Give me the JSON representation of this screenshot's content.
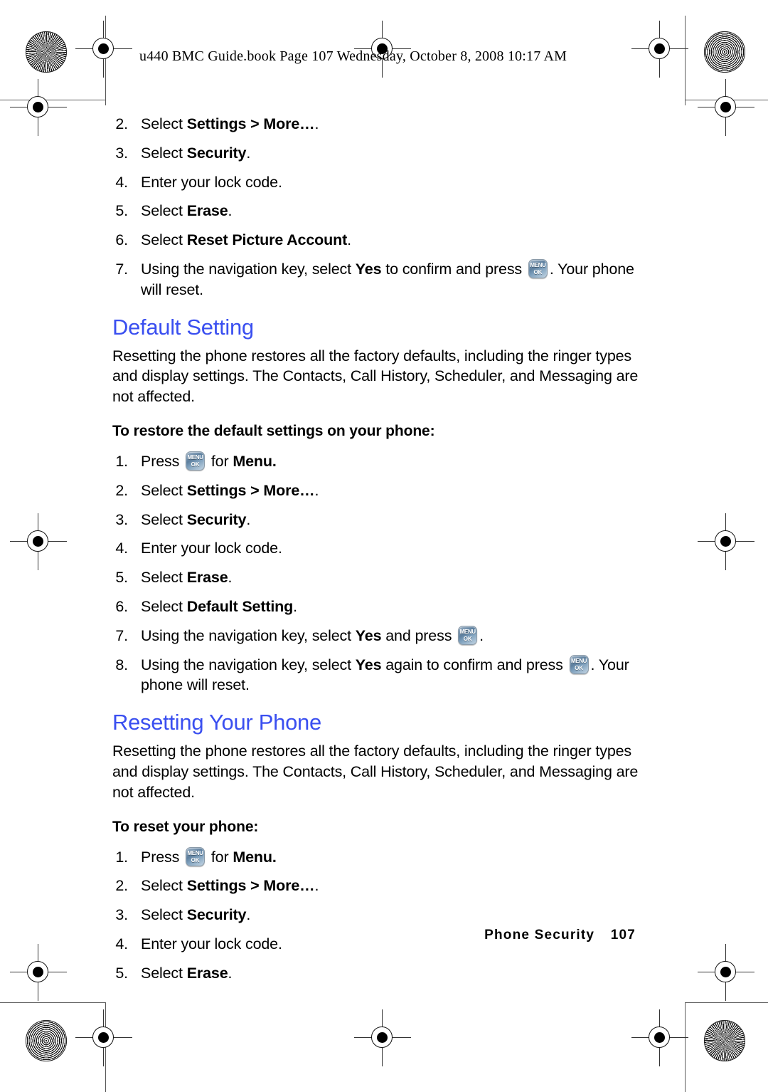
{
  "header": {
    "book_line": "u440 BMC Guide.book  Page 107  Wednesday, October 8, 2008  10:17 AM"
  },
  "keycap": {
    "line1": "MENU",
    "line2": "OK",
    "icon_name": "menu-ok-key-icon"
  },
  "colors": {
    "heading_blue": "#3a4ff0",
    "body_black": "#000000",
    "page_white": "#ffffff"
  },
  "list_top": {
    "items": [
      {
        "num": "2.",
        "pre": "Select ",
        "bold": "Settings > More…",
        "post": "."
      },
      {
        "num": "3.",
        "pre": "Select ",
        "bold": "Security",
        "post": "."
      },
      {
        "num": "4.",
        "pre": "Enter your lock code.",
        "bold": "",
        "post": ""
      },
      {
        "num": "5.",
        "pre": "Select ",
        "bold": "Erase",
        "post": "."
      },
      {
        "num": "6.",
        "pre": "Select ",
        "bold": "Reset Picture Account",
        "post": "."
      },
      {
        "num": "7.",
        "pre": "Using the navigation key, select ",
        "bold": "Yes",
        "post": " to confirm and press ",
        "post2": ". Your phone will reset.",
        "has_key": true
      }
    ]
  },
  "section_default": {
    "heading": "Default Setting",
    "paragraph": "Resetting the phone restores all the factory defaults, including the ringer types and display settings. The Contacts, Call History, Scheduler, and Messaging are not affected.",
    "leadin": "To restore the default settings on your phone:",
    "items": [
      {
        "num": "1.",
        "pre": "Press ",
        "bold": "",
        "post": " for ",
        "post2": "Menu.",
        "has_key": true,
        "key_position": "mid",
        "post2_bold": true
      },
      {
        "num": "2.",
        "pre": "Select ",
        "bold": "Settings > More…",
        "post": "."
      },
      {
        "num": "3.",
        "pre": "Select ",
        "bold": "Security",
        "post": "."
      },
      {
        "num": "4.",
        "pre": "Enter your lock code.",
        "bold": "",
        "post": ""
      },
      {
        "num": "5.",
        "pre": "Select ",
        "bold": "Erase",
        "post": "."
      },
      {
        "num": "6.",
        "pre": "Select ",
        "bold": "Default Setting",
        "post": "."
      },
      {
        "num": "7.",
        "pre": "Using the navigation key, select ",
        "bold": "Yes",
        "post": " and press ",
        "post2": ".",
        "has_key": true
      },
      {
        "num": "8.",
        "pre": "Using the navigation key, select ",
        "bold": "Yes",
        "post": " again to confirm and press ",
        "post2": ". Your phone will reset.",
        "has_key": true
      }
    ]
  },
  "section_reset": {
    "heading": "Resetting Your Phone",
    "paragraph": "Resetting the phone restores all the factory defaults, including the ringer types and display settings. The Contacts, Call History, Scheduler, and Messaging are not affected.",
    "leadin": "To reset your phone:",
    "items": [
      {
        "num": "1.",
        "pre": "Press ",
        "bold": "",
        "post": " for ",
        "post2": "Menu.",
        "has_key": true,
        "key_position": "mid",
        "post2_bold": true
      },
      {
        "num": "2.",
        "pre": "Select ",
        "bold": "Settings > More…",
        "post": "."
      },
      {
        "num": "3.",
        "pre": "Select ",
        "bold": "Security",
        "post": "."
      },
      {
        "num": "4.",
        "pre": "Enter your lock code.",
        "bold": "",
        "post": ""
      },
      {
        "num": "5.",
        "pre": "Select ",
        "bold": "Erase",
        "post": "."
      }
    ]
  },
  "footer": {
    "chapter": "Phone Security",
    "page_number": "107"
  }
}
